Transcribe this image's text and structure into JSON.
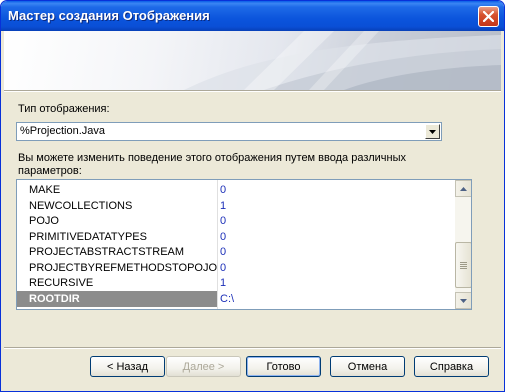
{
  "window": {
    "title": "Мастер создания Отображения",
    "close_icon": "close-icon",
    "titlebar_color": "#0a54dc",
    "close_color": "#d7522f"
  },
  "form": {
    "type_label": "Тип отображения:",
    "type_value": "%Projection.Java",
    "description": "Вы можете изменить поведение этого отображения путем ввода различных параметров:"
  },
  "params": {
    "rows": [
      {
        "key": "MAKE",
        "value": "0"
      },
      {
        "key": "NEWCOLLECTIONS",
        "value": "1"
      },
      {
        "key": "POJO",
        "value": "0"
      },
      {
        "key": "PRIMITIVEDATATYPES",
        "value": "0"
      },
      {
        "key": "PROJECTABSTRACTSTREAM",
        "value": "0"
      },
      {
        "key": "PROJECTBYREFMETHODSTOPOJO",
        "value": "0"
      },
      {
        "key": "RECURSIVE",
        "value": "1"
      },
      {
        "key": "ROOTDIR",
        "value": "C:\\"
      }
    ],
    "selected_key": "ROOTDIR",
    "value_color": "#1c2fb8",
    "selection_color": "#8c8c8c"
  },
  "buttons": {
    "back": "< Назад",
    "next": "Далее >",
    "finish": "Готово",
    "cancel": "Отмена",
    "help": "Справка"
  }
}
